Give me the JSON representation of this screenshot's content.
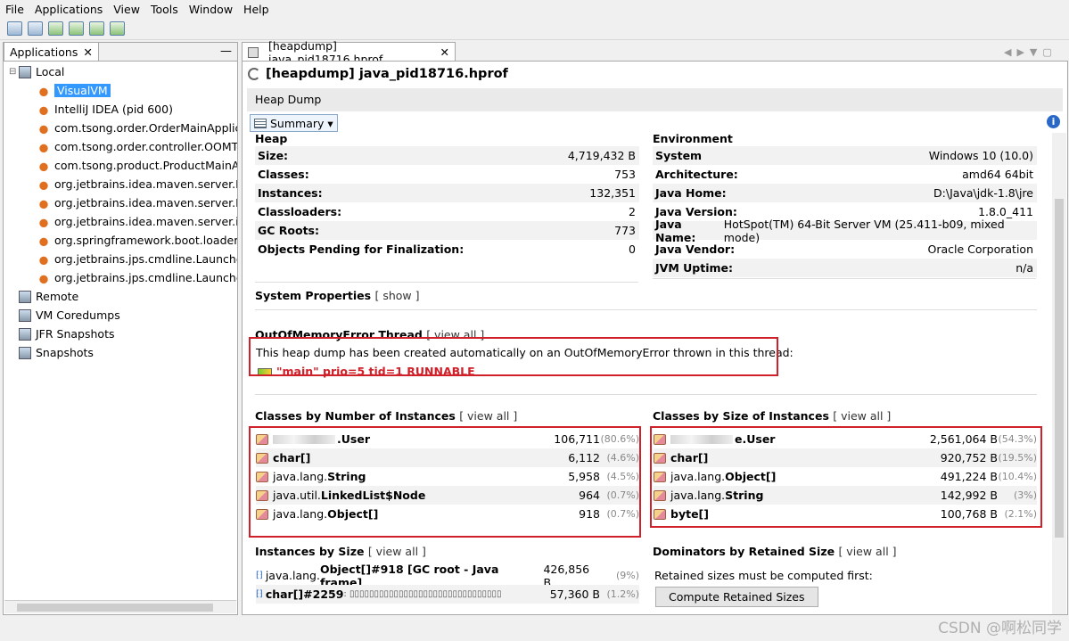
{
  "menu": [
    "File",
    "Applications",
    "View",
    "Tools",
    "Window",
    "Help"
  ],
  "left": {
    "tab": "Applications",
    "tree": [
      {
        "label": "Local",
        "level": 0
      },
      {
        "label": "VisualVM",
        "level": 1,
        "selected": true
      },
      {
        "label": "IntelliJ IDEA (pid 600)",
        "level": 1
      },
      {
        "label": "com.tsong.order.OrderMainApplica",
        "level": 1
      },
      {
        "label": "com.tsong.order.controller.OOMTe",
        "level": 1
      },
      {
        "label": "com.tsong.product.ProductMainAp",
        "level": 1
      },
      {
        "label": "org.jetbrains.idea.maven.server.Re",
        "level": 1
      },
      {
        "label": "org.jetbrains.idea.maven.server.Re",
        "level": 1
      },
      {
        "label": "org.jetbrains.idea.maven.server.ind",
        "level": 1
      },
      {
        "label": "org.springframework.boot.loader.P",
        "level": 1
      },
      {
        "label": "org.jetbrains.jps.cmdline.Launcher (",
        "level": 1
      },
      {
        "label": "org.jetbrains.jps.cmdline.Launcher (",
        "level": 1
      },
      {
        "label": "Remote",
        "level": 0
      },
      {
        "label": "VM Coredumps",
        "level": 0
      },
      {
        "label": "JFR Snapshots",
        "level": 0
      },
      {
        "label": "Snapshots",
        "level": 0
      }
    ]
  },
  "doc": {
    "tab": "[heapdump] java_pid18716.hprof",
    "title": "[heapdump] java_pid18716.hprof",
    "bar": "Heap Dump",
    "view": "Summary"
  },
  "heap": {
    "title": "Heap",
    "rows": [
      {
        "k": "Size:",
        "v": "4,719,432 B"
      },
      {
        "k": "Classes:",
        "v": "753"
      },
      {
        "k": "Instances:",
        "v": "132,351"
      },
      {
        "k": "Classloaders:",
        "v": "2"
      },
      {
        "k": "GC Roots:",
        "v": "773"
      },
      {
        "k": "Objects Pending for Finalization:",
        "v": "0"
      }
    ]
  },
  "env": {
    "title": "Environment",
    "rows": [
      {
        "k": "System",
        "v": "Windows 10 (10.0)"
      },
      {
        "k": "Architecture:",
        "v": "amd64 64bit"
      },
      {
        "k": "Java Home:",
        "v": "D:\\Java\\jdk-1.8\\jre"
      },
      {
        "k": "Java Version:",
        "v": "1.8.0_411"
      },
      {
        "k": "Java Name:",
        "v": "HotSpot(TM) 64-Bit Server VM (25.411-b09, mixed mode)"
      },
      {
        "k": "Java Vendor:",
        "v": "Oracle Corporation"
      },
      {
        "k": "JVM Uptime:",
        "v": "n/a"
      }
    ]
  },
  "sysprops": {
    "title": "System Properties",
    "link": "[ show ]"
  },
  "oom": {
    "title": "OutOfMemoryError Thread",
    "link": "[ view all ]",
    "text": "This heap dump has been created automatically on an OutOfMemoryError thrown in this thread:",
    "thread": "\"main\" prio=5 tid=1 RUNNABLE"
  },
  "byCount": {
    "title": "Classes by Number of Instances",
    "link": "[ view all ]",
    "rows": [
      {
        "pre": "",
        "name": ".User",
        "v": "106,711",
        "p": "(80.6%)"
      },
      {
        "pre": "",
        "name": "char[]",
        "v": "6,112",
        "p": "(4.6%)"
      },
      {
        "pre": "java.lang.",
        "name": "String",
        "v": "5,958",
        "p": "(4.5%)"
      },
      {
        "pre": "java.util.",
        "name": "LinkedList$Node",
        "v": "964",
        "p": "(0.7%)"
      },
      {
        "pre": "java.lang.",
        "name": "Object[]",
        "v": "918",
        "p": "(0.7%)"
      }
    ]
  },
  "bySize": {
    "title": "Classes by Size of Instances",
    "link": "[ view all ]",
    "rows": [
      {
        "pre": "",
        "name": "e.User",
        "v": "2,561,064 B",
        "p": "(54.3%)"
      },
      {
        "pre": "",
        "name": "char[]",
        "v": "920,752 B",
        "p": "(19.5%)"
      },
      {
        "pre": "java.lang.",
        "name": "Object[]",
        "v": "491,224 B",
        "p": "(10.4%)"
      },
      {
        "pre": "java.lang.",
        "name": "String",
        "v": "142,992 B",
        "p": "(3%)"
      },
      {
        "pre": "",
        "name": "byte[]",
        "v": "100,768 B",
        "p": "(2.1%)"
      }
    ]
  },
  "instSize": {
    "title": "Instances by Size",
    "link": "[ view all ]",
    "rows": [
      {
        "a": "java.lang.",
        "b": "Object[]#918 [GC root - Java frame]",
        "v": "426,856 B",
        "p": "(9%)"
      },
      {
        "a": "",
        "b": "char[]#2259",
        "c": " : ▯▯▯▯▯▯▯▯▯▯▯▯▯▯▯▯▯▯▯▯▯▯▯▯▯▯▯▯▯▯▯",
        "v": "57,360 B",
        "p": "(1.2%)"
      }
    ]
  },
  "dom": {
    "title": "Dominators by Retained Size",
    "link": "[ view all ]",
    "note": "Retained sizes must be computed first:",
    "button": "Compute Retained Sizes"
  },
  "watermark": "CSDN @啊松同学"
}
